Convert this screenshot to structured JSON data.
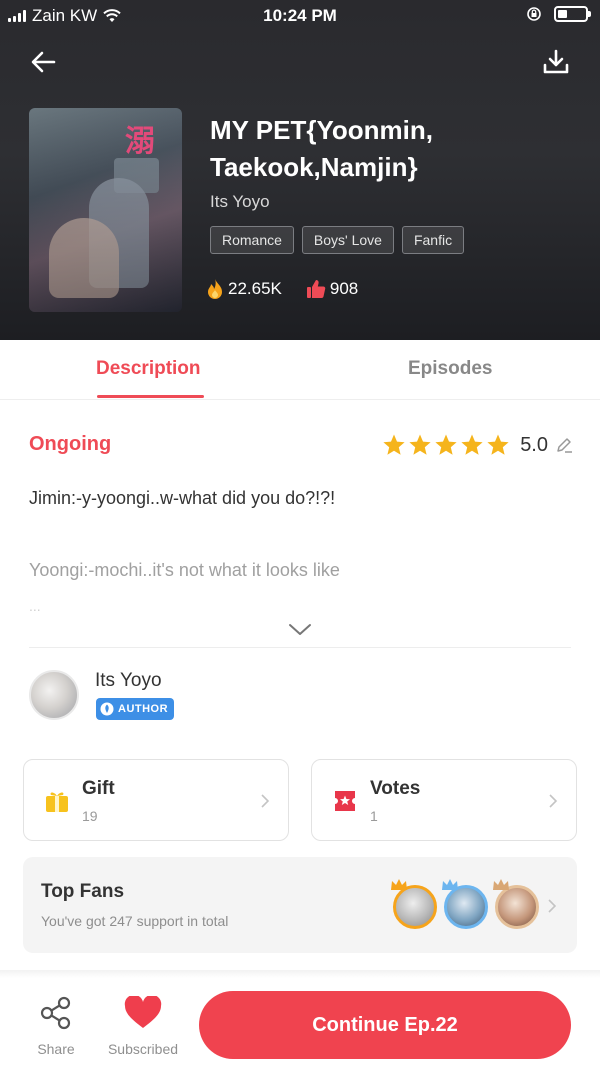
{
  "status_bar": {
    "carrier": "Zain KW",
    "time": "10:24 PM"
  },
  "header": {
    "back_icon": "arrow-left-icon",
    "download_icon": "download-icon"
  },
  "book": {
    "cover_title": "溺",
    "title": "MY PET{Yoonmin, Taekook,Namjin}",
    "author": "Its Yoyo",
    "tags": [
      "Romance",
      "Boys' Love",
      "Fanfic"
    ],
    "views": "22.65K",
    "likes": "908"
  },
  "tabs": [
    {
      "label": "Description",
      "active": true
    },
    {
      "label": "Episodes",
      "active": false
    }
  ],
  "description": {
    "status": "Ongoing",
    "rating": "5.0",
    "stars": 5,
    "line1": "Jimin:-y-yoongi..w-what did you do?!?!",
    "line2": "Yoongi:-mochi..it's not what it looks like",
    "line3": "..."
  },
  "author_section": {
    "name": "Its Yoyo",
    "badge": "AUTHOR"
  },
  "cards": {
    "gift": {
      "label": "Gift",
      "count": "19"
    },
    "votes": {
      "label": "Votes",
      "count": "1"
    }
  },
  "top_fans": {
    "label": "Top Fans",
    "subtitle": "You've got 247 support in total"
  },
  "bottom_bar": {
    "share_label": "Share",
    "subscribed_label": "Subscribed",
    "continue_label": "Continue Ep.22"
  },
  "colors": {
    "accent": "#ef4b56",
    "button": "#f0434f",
    "badge": "#3d8fe6",
    "star": "#f5b41c"
  }
}
